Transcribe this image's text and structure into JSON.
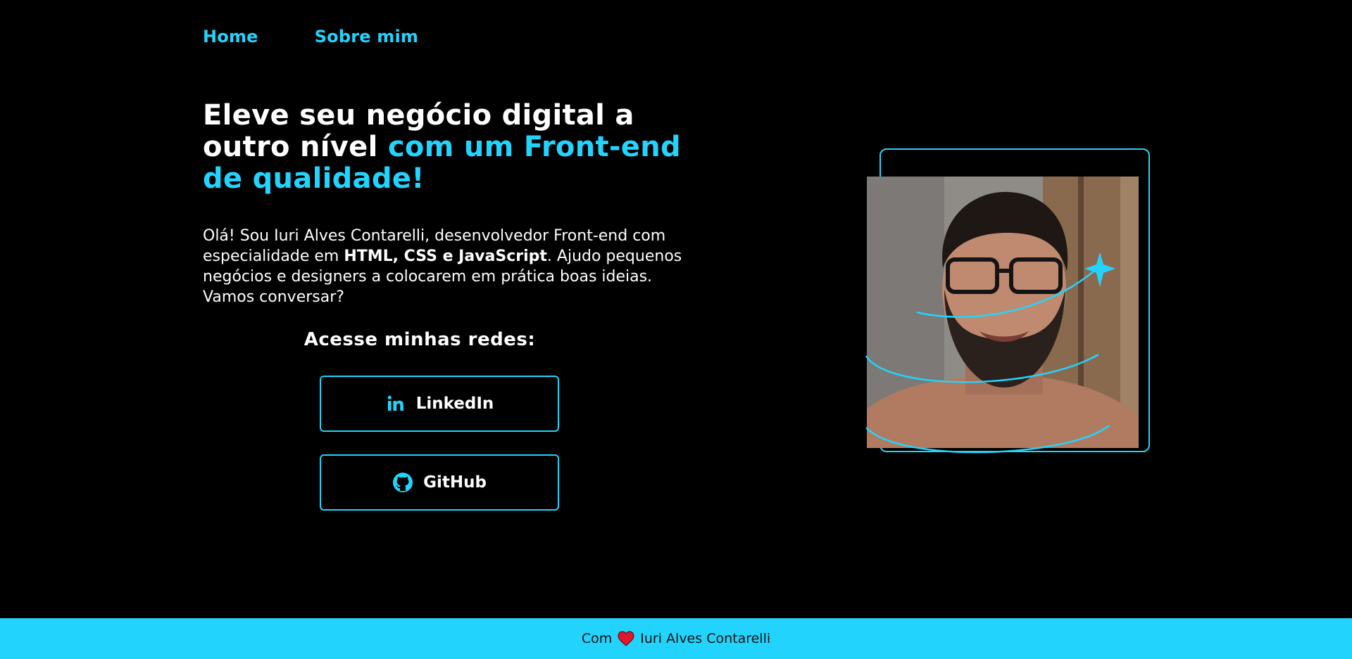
{
  "nav": {
    "items": [
      {
        "label": "Home"
      },
      {
        "label": "Sobre mim"
      }
    ]
  },
  "hero": {
    "headline_part1": "Eleve seu negócio digital a outro nível ",
    "headline_accent": "com um Front-end de qualidade!",
    "intro_part1": "Olá! Sou Iuri Alves Contarelli, desenvolvedor Front-end com especialidade em ",
    "intro_bold": "HTML, CSS e JavaScript",
    "intro_part2": ". Ajudo pequenos negócios e designers a colocarem em prática boas ideias. Vamos conversar?"
  },
  "social": {
    "title": "Acesse minhas redes:",
    "links": [
      {
        "label": "LinkedIn",
        "icon": "linkedin-icon"
      },
      {
        "label": "GitHub",
        "icon": "github-icon"
      }
    ]
  },
  "footer": {
    "prefix": "Com",
    "icon": "heart-icon",
    "name": "Iuri Alves Contarelli"
  },
  "colors": {
    "accent": "#22d4fd",
    "background": "#000000",
    "text": "#ffffff",
    "heart": "#e0162b"
  }
}
